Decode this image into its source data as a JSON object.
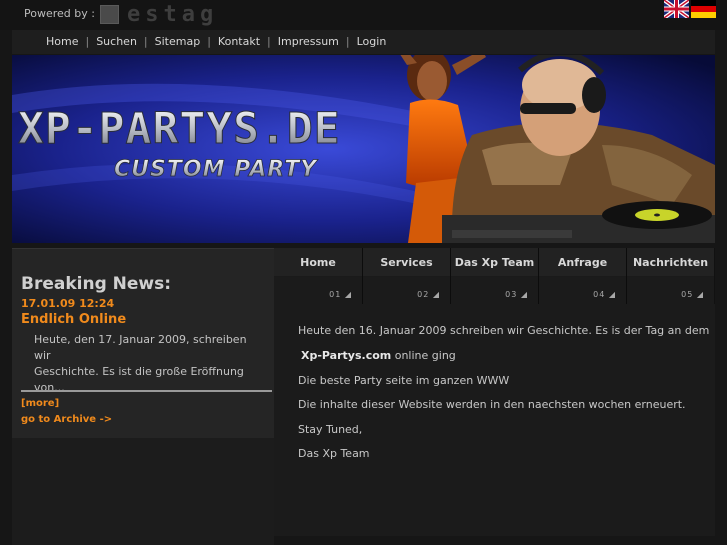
{
  "topbar": {
    "powered_by": "Powered by :",
    "logo_text": "estag",
    "flags": [
      "uk-flag",
      "german-flag"
    ]
  },
  "top_nav": {
    "links": [
      "Home",
      "Suchen",
      "Sitemap",
      "Kontakt",
      "Impressum",
      "Login"
    ],
    "separator": "|"
  },
  "banner": {
    "title": "XP-PARTYS.DE",
    "subtitle": "CUSTOM PARTY"
  },
  "breaking_news": {
    "heading": "Breaking News:",
    "date": "17.01.09 12:24",
    "headline": "Endlich Online",
    "text_line1": "Heute, den 17. Januar 2009, schreiben wir",
    "text_line2": "Geschichte. Es ist die große Eröffnung",
    "text_line3": "von...",
    "more": "[more]",
    "archive": "go to Archive ->"
  },
  "tabs": [
    {
      "label": "Home",
      "num": "01"
    },
    {
      "label": "Services",
      "num": "02"
    },
    {
      "label": "Das Xp Team",
      "num": "03"
    },
    {
      "label": "Anfrage",
      "num": "04"
    },
    {
      "label": "Nachrichten",
      "num": "05"
    }
  ],
  "content": {
    "line1": "Heute den 16. Januar 2009 schreiben wir Geschichte. Es is der Tag an dem",
    "line2_bold": "Xp-Partys.com",
    "line2_rest": " online ging",
    "line3": "Die beste Party seite im ganzen WWW",
    "line4": "Die inhalte dieser Website werden in den naechsten wochen erneuert.",
    "line5": "Stay Tuned,",
    "line6": "Das Xp Team"
  },
  "colors": {
    "accent": "#f08a1c",
    "background": "#161616",
    "banner_bg": "#0a1048"
  }
}
